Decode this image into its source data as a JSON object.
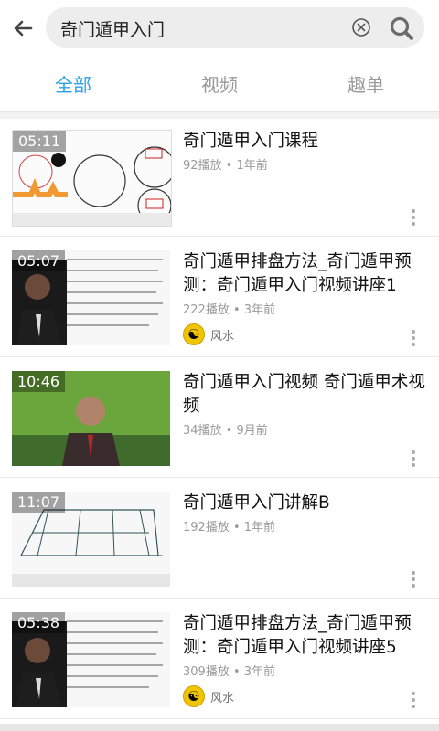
{
  "search": {
    "query": "奇门遁甲入门"
  },
  "tabs": [
    {
      "label": "全部"
    },
    {
      "label": "视频"
    },
    {
      "label": "趣单"
    }
  ],
  "results": [
    {
      "duration": "05:11",
      "title": "奇门遁甲入门课程",
      "meta": "92播放 • 1年前"
    },
    {
      "duration": "05:07",
      "title": "奇门遁甲排盘方法_奇门遁甲预测：奇门遁甲入门视频讲座1",
      "meta": "222播放 • 3年前",
      "tag": "风水"
    },
    {
      "duration": "10:46",
      "title": "奇门遁甲入门视频 奇门遁甲术视频",
      "meta": "34播放 • 9月前"
    },
    {
      "duration": "11:07",
      "title": "奇门遁甲入门讲解B",
      "meta": "192播放 • 1年前"
    },
    {
      "duration": "05:38",
      "title": "奇门遁甲排盘方法_奇门遁甲预测：奇门遁甲入门视频讲座5",
      "meta": "309播放 • 3年前",
      "tag": "风水"
    }
  ],
  "colors": {
    "accent": "#2aa0e8",
    "tab_inactive": "#9a9a9a"
  },
  "icons": {
    "back": "arrow-left-icon",
    "clear": "clear-circle-x-icon",
    "search": "search-icon",
    "more": "vertical-dots-icon",
    "tag": "yin-yang-icon"
  }
}
